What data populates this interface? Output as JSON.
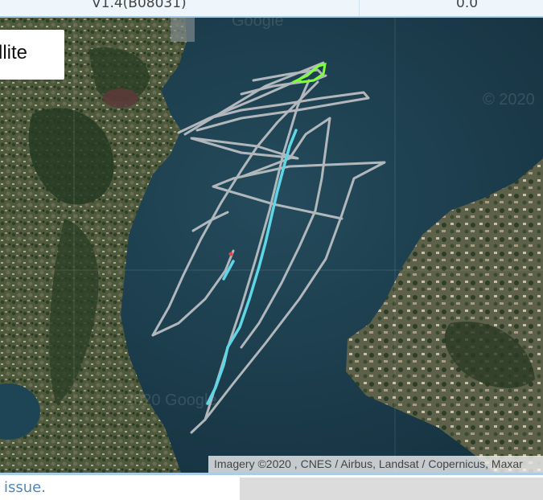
{
  "top_row": {
    "left_value": "V1.4(B08031)",
    "right_value": "0.0"
  },
  "map": {
    "type_button_label": "llite",
    "attribution": "Imagery ©2020 , CNES / Airbus, Landsat / Copernicus, Maxar",
    "watermarks": [
      "Google",
      "© 2020",
      "2020 Google"
    ],
    "colors": {
      "water": "#1d3a4a",
      "land": "#4a5a3a",
      "track_gray": "#b9bec2",
      "track_cyan": "#5fd6e6",
      "track_green": "#7dff3a",
      "marker_red": "#e0454a"
    }
  },
  "footer": {
    "link_text": "issue."
  }
}
